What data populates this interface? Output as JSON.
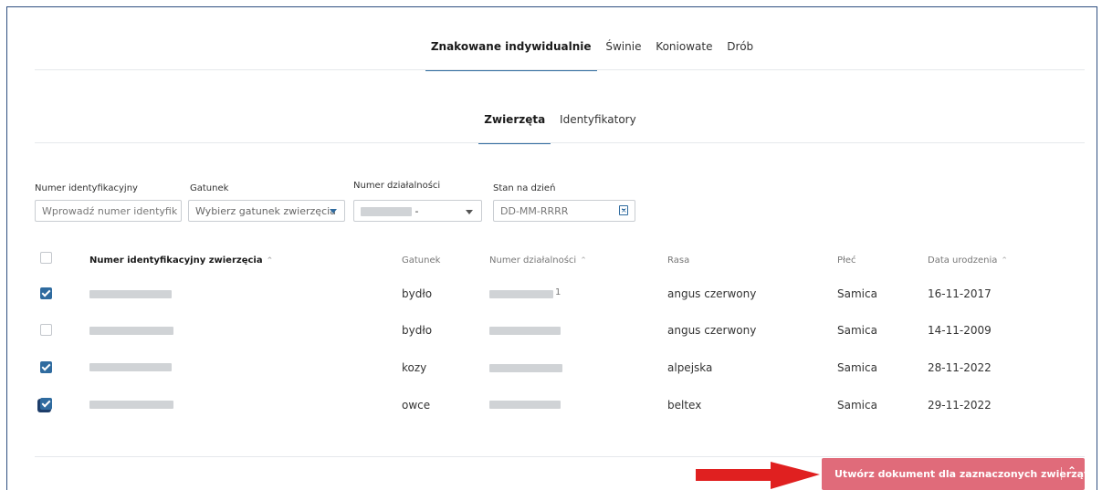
{
  "tabs_top": [
    "Znakowane indywidualnie",
    "Świnie",
    "Koniowate",
    "Drób"
  ],
  "tabs_sub": [
    "Zwierzęta",
    "Identyfikatory"
  ],
  "filters": {
    "id_label": "Numer identyfikacyjny",
    "id_placeholder": "Wprowadź numer identyfik",
    "species_label": "Gatunek",
    "species_placeholder": "Wybierz gatunek zwierzęcia",
    "activity_label": "Numer działalności",
    "activity_suffix": "-",
    "date_label": "Stan na dzień",
    "date_placeholder": "DD-MM-RRRR"
  },
  "table": {
    "headers": {
      "animal_id": "Numer identyfikacyjny zwierzęcia",
      "species": "Gatunek",
      "activity": "Numer działalności",
      "breed": "Rasa",
      "sex": "Płeć",
      "birth": "Data urodzenia"
    },
    "sort_icon": "⌃",
    "rows": [
      {
        "checked": true,
        "species": "bydło",
        "activity_suffix": "1",
        "breed": "angus czerwony",
        "sex": "Samica",
        "birth": "16-11-2017"
      },
      {
        "checked": false,
        "species": "bydło",
        "activity_suffix": "",
        "breed": "angus czerwony",
        "sex": "Samica",
        "birth": "14-11-2009"
      },
      {
        "checked": true,
        "species": "kozy",
        "activity_suffix": "",
        "breed": "alpejska",
        "sex": "Samica",
        "birth": "28-11-2022"
      },
      {
        "checked": true,
        "species": "owce",
        "activity_suffix": "",
        "breed": "beltex",
        "sex": "Samica",
        "birth": "29-11-2022"
      }
    ]
  },
  "actions": {
    "create_label": "Utwórz dokument dla zaznaczonych zwierząt",
    "chevron": "⌃"
  },
  "colors": {
    "accent": "#2f6b9f",
    "button": "#e06b7a",
    "arrow": "#e02020"
  }
}
